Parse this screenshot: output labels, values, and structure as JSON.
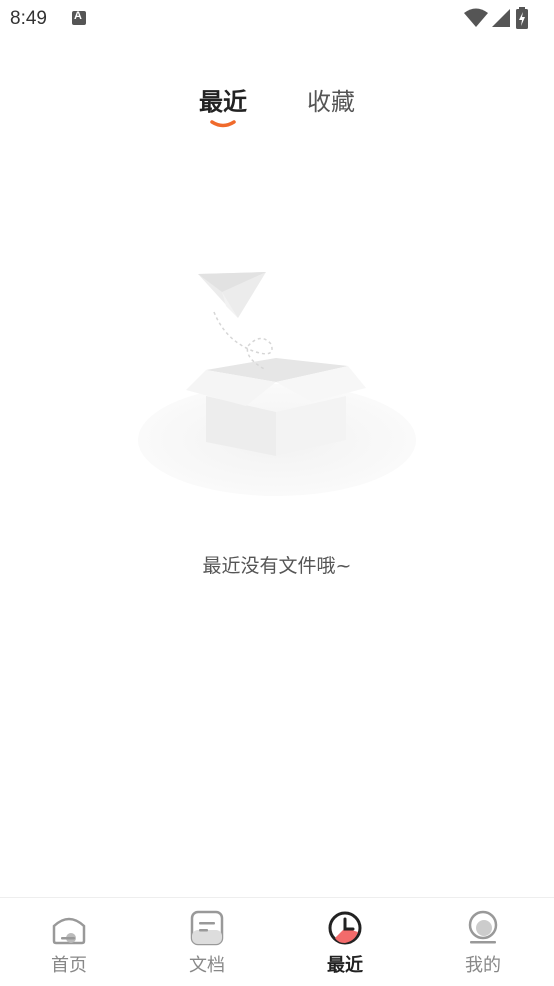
{
  "status_bar": {
    "time": "8:49",
    "notification_letter": "A"
  },
  "tabs": [
    {
      "label": "最近",
      "active": true
    },
    {
      "label": "收藏",
      "active": false
    }
  ],
  "empty_state": {
    "message": "最近没有文件哦~"
  },
  "bottom_nav": {
    "items": [
      {
        "label": "首页",
        "icon": "home-icon"
      },
      {
        "label": "文档",
        "icon": "document-icon"
      },
      {
        "label": "最近",
        "icon": "clock-icon",
        "active": true
      },
      {
        "label": "我的",
        "icon": "profile-icon"
      }
    ]
  },
  "colors": {
    "accent": "#f06a2b",
    "active_text": "#222222",
    "inactive_text": "#888888"
  }
}
